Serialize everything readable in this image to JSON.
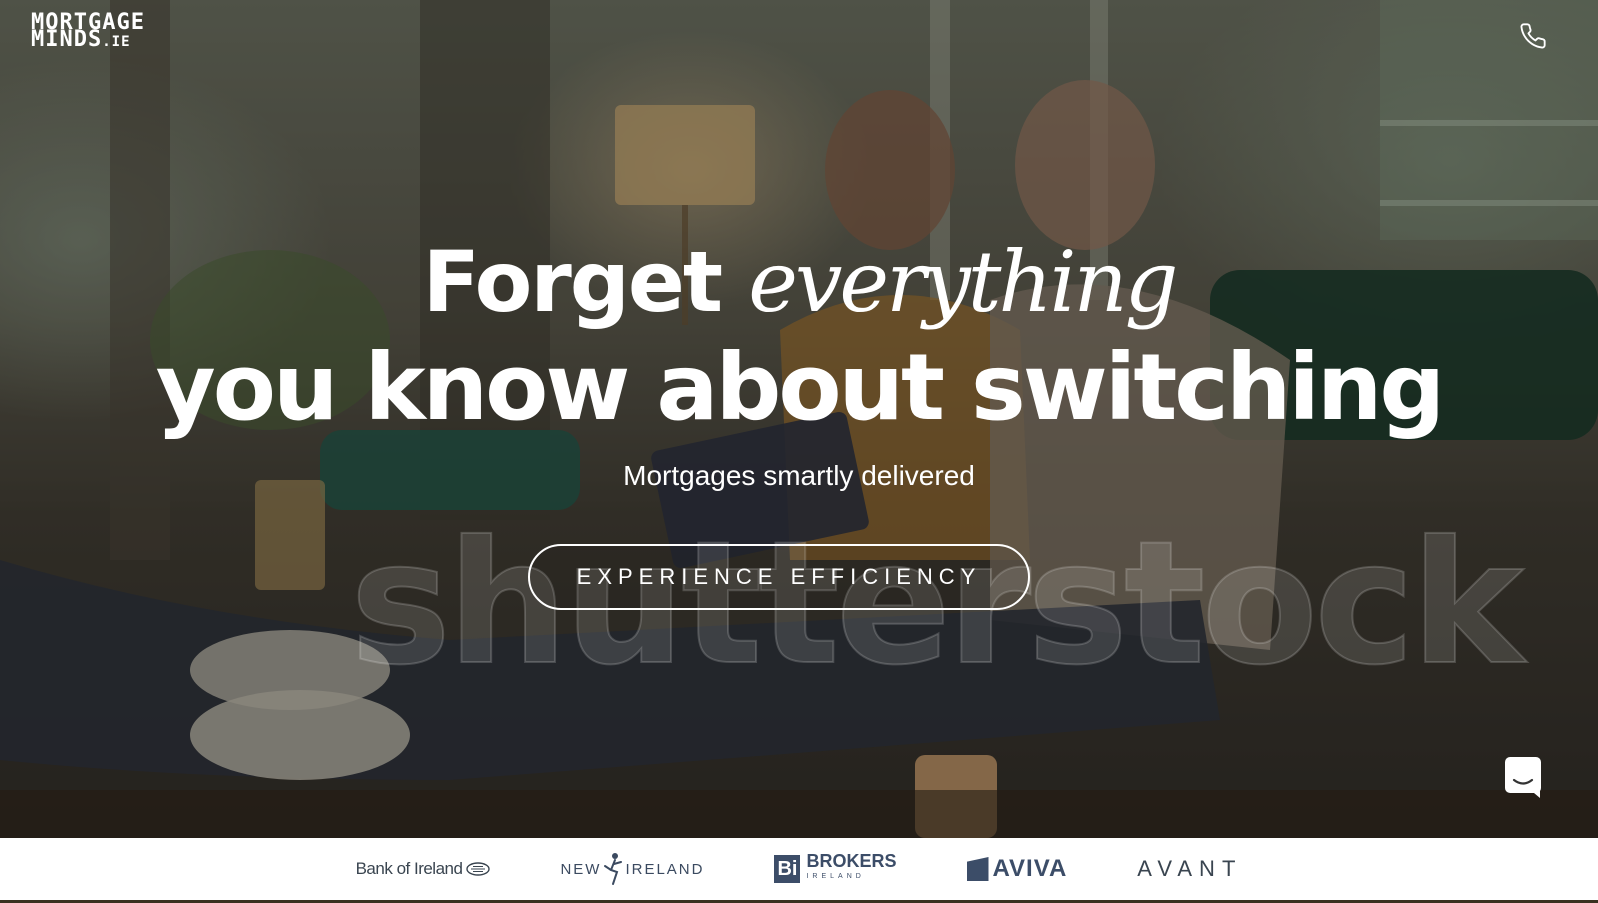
{
  "header": {
    "logo_line1": "MORTGAGE",
    "logo_line2": "MINDS",
    "logo_suffix": ".IE",
    "phone_icon": "phone-icon"
  },
  "hero": {
    "headline_word1": "Forget",
    "headline_italic": "everything",
    "headline_line2": "you know about switching",
    "subtitle": "Mortgages smartly delivered",
    "cta_label": "EXPERIENCE EFFICIENCY",
    "watermark": "shutterstock"
  },
  "chat": {
    "icon": "chat-icon"
  },
  "partners": {
    "items": [
      {
        "name": "Bank of Ireland"
      },
      {
        "name_left": "NEW",
        "name_right": "IRELAND"
      },
      {
        "mark": "Bi",
        "name": "BROKERS",
        "sub": "IRELAND"
      },
      {
        "name": "AVIVA"
      },
      {
        "name": "AVANT"
      }
    ]
  },
  "colors": {
    "text_primary": "#ffffff",
    "partner_navy": "#3c4d68",
    "partners_bg": "#ffffff"
  }
}
